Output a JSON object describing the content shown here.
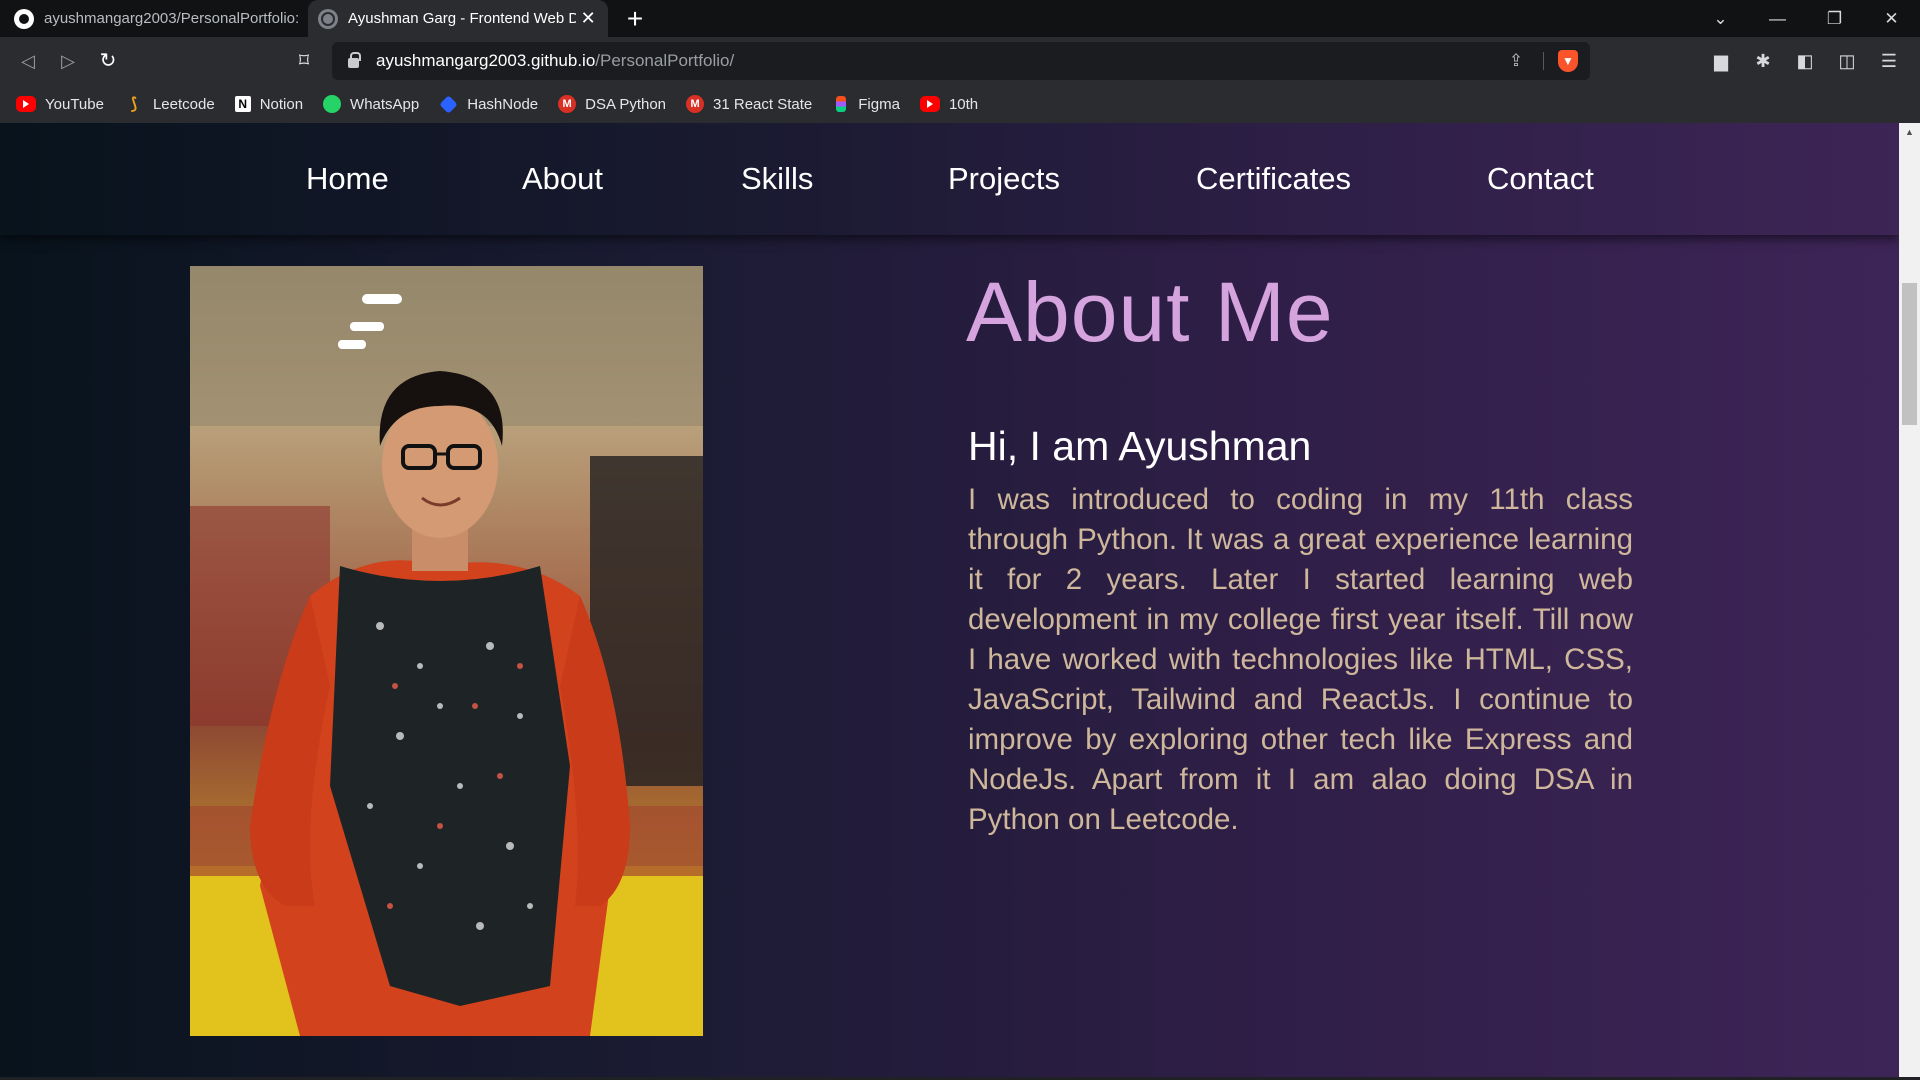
{
  "tabs": [
    {
      "title": "ayushmangarg2003/PersonalPortfolio:",
      "icon": "github-icon",
      "active": false
    },
    {
      "title": "Ayushman Garg - Frontend Web D",
      "icon": "globe-icon",
      "active": true
    }
  ],
  "tab_close_glyph": "✕",
  "new_tab_glyph": "+",
  "window_controls": {
    "dropdown": "⌄",
    "minimize": "—",
    "restore": "❐",
    "close": "✕"
  },
  "toolbar": {
    "back": "◁",
    "forward": "▷",
    "reload": "↻",
    "bookmark": "⌑",
    "url_host": "ayushmangarg2003.github.io",
    "url_path": "/PersonalPortfolio/",
    "share": "⇪",
    "brave": "▼"
  },
  "extensions": [
    "▆",
    "✱",
    "◧",
    "◫",
    "☰"
  ],
  "bookmarks": [
    {
      "label": "YouTube",
      "icon": "youtube-icon"
    },
    {
      "label": "Leetcode",
      "icon": "leetcode-icon"
    },
    {
      "label": "Notion",
      "icon": "notion-icon"
    },
    {
      "label": "WhatsApp",
      "icon": "whatsapp-icon"
    },
    {
      "label": "HashNode",
      "icon": "hashnode-icon"
    },
    {
      "label": "DSA Python",
      "icon": "gmail-icon"
    },
    {
      "label": "31 React State",
      "icon": "gmail-icon"
    },
    {
      "label": "Figma",
      "icon": "figma-icon"
    },
    {
      "label": "10th",
      "icon": "youtube-icon"
    }
  ],
  "bookmark_glyphs": {
    "leetcode": "⟆",
    "notion": "N",
    "gmail": "M",
    "whatsapp": ""
  },
  "site": {
    "nav": [
      "Home",
      "About",
      "Skills",
      "Projects",
      "Certificates",
      "Contact"
    ],
    "about": {
      "heading": "About Me",
      "greeting": "Hi, I am Ayushman",
      "body": "I was introduced to coding in my 11th class through Python. It was a great experience learning it for 2 years. Later I started learning web development in my college first year itself. Till now I have worked with technologies like HTML, CSS, JavaScript, Tailwind and ReactJs. I continue to improve by exploring other tech like Express and NodeJs. Apart from it I am alao doing DSA in Python on Leetcode."
    }
  },
  "scroll_up_glyph": "▲",
  "colors": {
    "heading": "#d5a3dd",
    "body_text": "#ceb79a",
    "nav_text": "#ffffff",
    "page_gradient_start": "#08131c",
    "page_gradient_end": "#3e2558"
  }
}
